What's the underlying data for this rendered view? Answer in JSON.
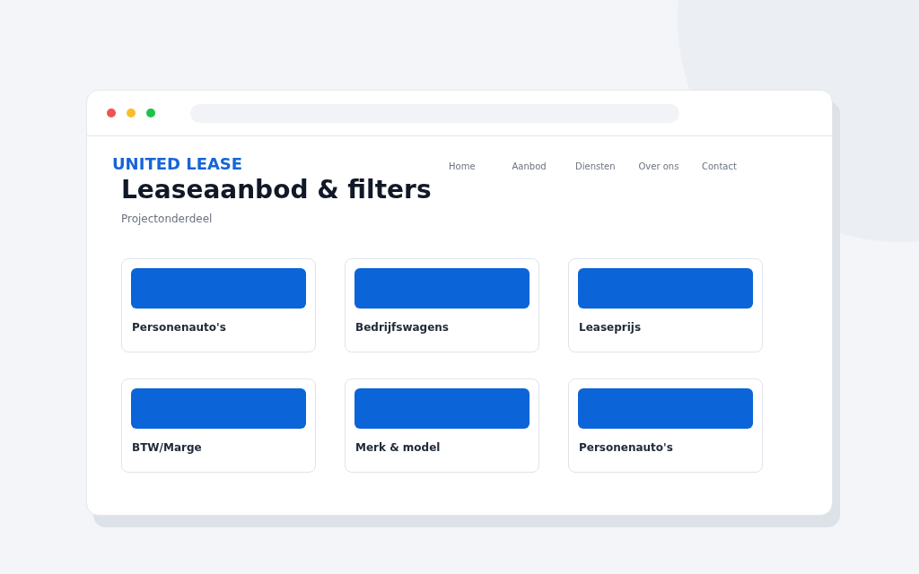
{
  "logo": "UNITED LEASE",
  "nav": [
    "Home",
    "Aanbod",
    "Diensten",
    "Over ons",
    "Contact"
  ],
  "title": "Leaseaanbod & filters",
  "subtitle": "Projectonderdeel",
  "cards": [
    {
      "label": "Personenauto's"
    },
    {
      "label": "Bedrijfswagens"
    },
    {
      "label": "Leaseprijs"
    },
    {
      "label": "BTW/Marge"
    },
    {
      "label": "Merk & model"
    },
    {
      "label": "Personenauto's"
    }
  ]
}
